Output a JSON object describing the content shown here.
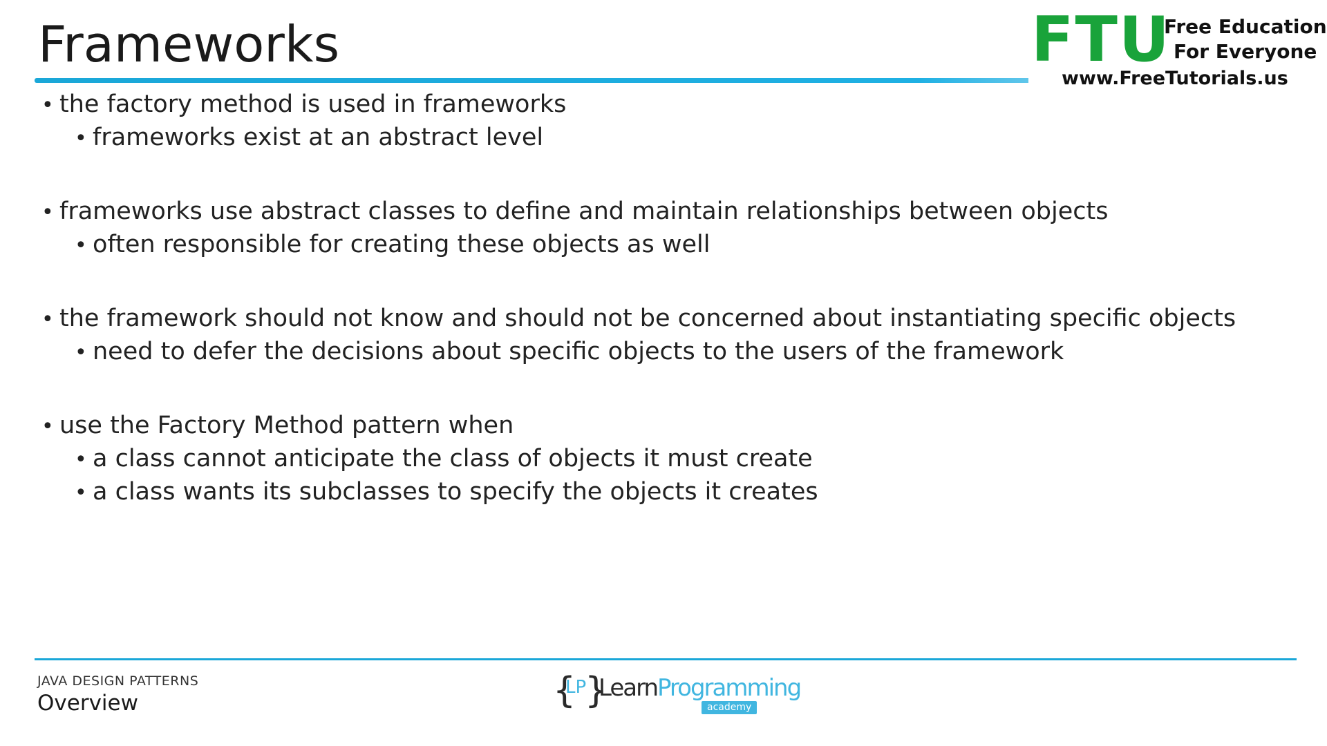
{
  "slide": {
    "title": "Frameworks",
    "bullets": [
      {
        "text": "the factory method is used in frameworks",
        "sub": [
          "frameworks  exist at an abstract level"
        ]
      },
      {
        "text": "frameworks use abstract classes to define and maintain relationships between objects",
        "sub": [
          "often responsible for creating these objects as well"
        ]
      },
      {
        "text": "the framework should not know and should not be concerned about instantiating specific objects",
        "sub": [
          "need to defer the decisions about specific objects to the users of the framework"
        ]
      },
      {
        "text": "use the Factory Method pattern when",
        "sub": [
          "a class cannot  anticipate the class of objects it must create",
          "a class wants its subclasses to specify the objects it creates"
        ]
      }
    ],
    "bullet_glyph": "•"
  },
  "watermark": {
    "mark": "FTU",
    "tagline_line1": "Free Education",
    "tagline_line2": "For Everyone",
    "url": "www.FreeTutorials.us",
    "color": "#19a33a"
  },
  "footer": {
    "course": "JAVA DESIGN PATTERNS",
    "section": "Overview",
    "logo": {
      "brace_left": "{",
      "initials": "LP",
      "brace_right": "}",
      "word_a": "Learn",
      "word_b": "Programming",
      "badge": "academy"
    },
    "accent": "#1aa7d8"
  }
}
